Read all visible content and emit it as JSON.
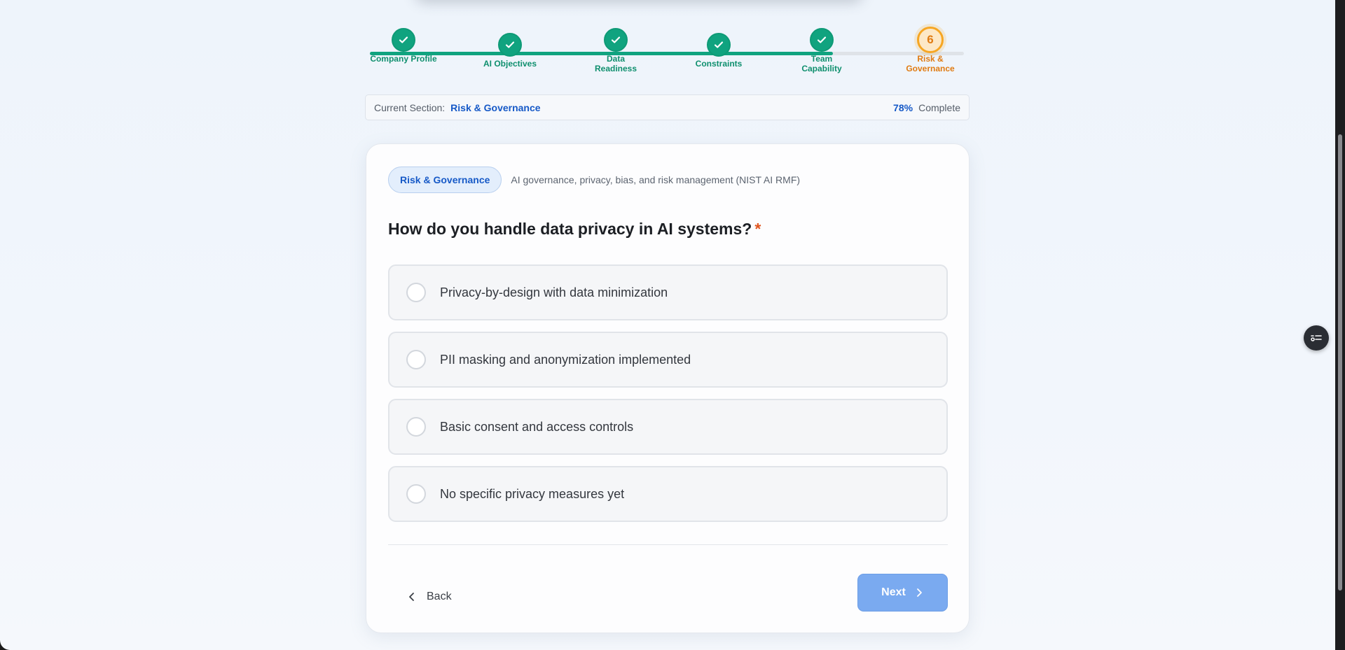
{
  "stepper": {
    "progress_fraction": 0.78,
    "steps": [
      {
        "label": "Company Profile",
        "status": "done"
      },
      {
        "label": "AI Objectives",
        "status": "done"
      },
      {
        "label": "Data Readiness",
        "status": "done"
      },
      {
        "label": "Constraints",
        "status": "done"
      },
      {
        "label": "Team Capability",
        "status": "done"
      },
      {
        "label": "Risk & Governance",
        "status": "active",
        "number": "6"
      }
    ]
  },
  "section_bar": {
    "prefix": "Current Section:",
    "name": "Risk & Governance",
    "percent": "78%",
    "complete_label": "Complete"
  },
  "card": {
    "tag": "Risk & Governance",
    "tag_description": "AI governance, privacy, bias, and risk management (NIST AI RMF)",
    "question": "How do you handle data privacy in AI systems?",
    "required_mark": "*",
    "options": [
      "Privacy-by-design with data minimization",
      "PII masking and anonymization implemented",
      "Basic consent and access controls",
      "No specific privacy measures yet"
    ],
    "back_label": "Back",
    "next_label": "Next"
  },
  "colors": {
    "done": "#10a37f",
    "active": "#f6a623",
    "accent": "#1659c7",
    "next_button": "#7aaaf0"
  },
  "icons": {
    "check": "check-icon",
    "back": "chevron-left-icon",
    "next": "chevron-right-icon",
    "float": "checklist-icon"
  }
}
